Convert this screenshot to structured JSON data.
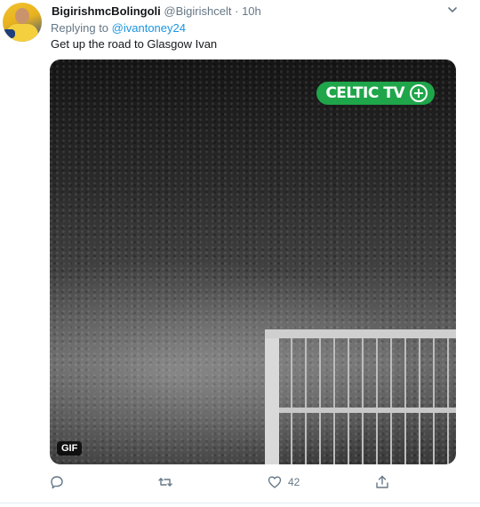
{
  "tweet": {
    "author_name": "BigirishmcBolingoli",
    "author_handle": "@Bigirishcelt",
    "separator": "·",
    "time": "10h",
    "reply_prefix": "Replying to",
    "reply_to": "@ivantoney24",
    "text": "Get up the road to Glasgow Ivan",
    "media": {
      "watermark": "CELTIC TV",
      "type_badge": "GIF"
    },
    "actions": {
      "reply": {
        "icon": "reply-icon",
        "count": ""
      },
      "retweet": {
        "icon": "retweet-icon",
        "count": ""
      },
      "like": {
        "icon": "heart-icon",
        "count": "42"
      },
      "share": {
        "icon": "share-icon",
        "count": ""
      }
    }
  },
  "colors": {
    "name": "#14171a",
    "secondary": "#657786",
    "link": "#1b95e0",
    "celtic_green": "#1fa64a"
  }
}
